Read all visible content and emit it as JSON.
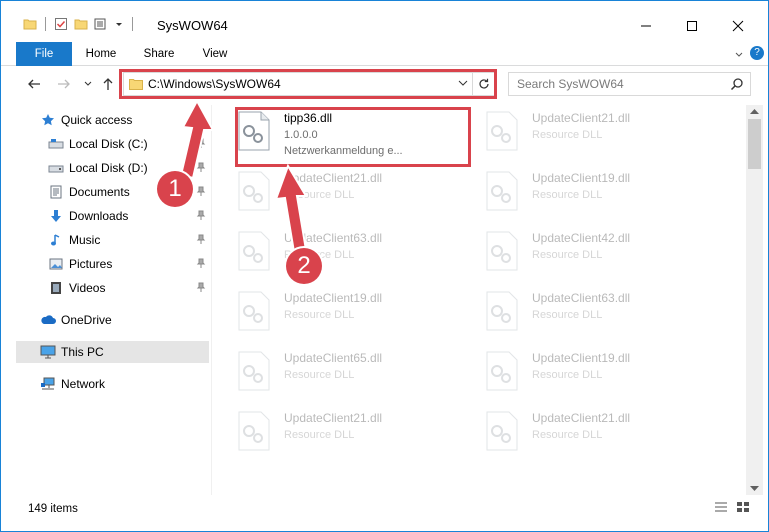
{
  "window": {
    "title": "SysWOW64"
  },
  "ribbon": {
    "tabs": [
      "File",
      "Home",
      "Share",
      "View"
    ]
  },
  "address": {
    "path": "C:\\Windows\\SysWOW64"
  },
  "search": {
    "placeholder": "Search SysWOW64"
  },
  "sidebar": {
    "items": [
      {
        "label": "Quick access",
        "icon": "star-icon",
        "pinned": false
      },
      {
        "label": "Local Disk (C:)",
        "icon": "drive-icon",
        "pinned": true
      },
      {
        "label": "Local Disk (D:)",
        "icon": "drive-icon",
        "pinned": true
      },
      {
        "label": "Documents",
        "icon": "documents-icon",
        "pinned": true
      },
      {
        "label": "Downloads",
        "icon": "download-arrow-icon",
        "pinned": true
      },
      {
        "label": "Music",
        "icon": "music-note-icon",
        "pinned": true
      },
      {
        "label": "Pictures",
        "icon": "pictures-icon",
        "pinned": true
      },
      {
        "label": "Videos",
        "icon": "film-icon",
        "pinned": true
      },
      {
        "label": "OneDrive",
        "icon": "cloud-icon",
        "pinned": false
      },
      {
        "label": "This PC",
        "icon": "monitor-icon",
        "pinned": false,
        "selected": true
      },
      {
        "label": "Network",
        "icon": "network-icon",
        "pinned": false
      }
    ]
  },
  "files": [
    {
      "name": "tipp36.dll",
      "line2": "1.0.0.0",
      "line3": "Netzwerkanmeldung e...",
      "highlighted": true
    },
    {
      "name": "UpdateClient21.dll",
      "line2": "Resource DLL",
      "faded": true
    },
    {
      "name": "UpdateClient21.dll",
      "line2": "Resource DLL",
      "faded": true
    },
    {
      "name": "UpdateClient19.dll",
      "line2": "Resource DLL",
      "faded": true
    },
    {
      "name": "UpdateClient63.dll",
      "line2": "Resource DLL",
      "faded": true
    },
    {
      "name": "UpdateClient42.dll",
      "line2": "Resource DLL",
      "faded": true
    },
    {
      "name": "UpdateClient19.dll",
      "line2": "Resource DLL",
      "faded": true
    },
    {
      "name": "UpdateClient63.dll",
      "line2": "Resource DLL",
      "faded": true
    },
    {
      "name": "UpdateClient65.dll",
      "line2": "Resource DLL",
      "faded": true
    },
    {
      "name": "UpdateClient19.dll",
      "line2": "Resource DLL",
      "faded": true
    },
    {
      "name": "UpdateClient21.dll",
      "line2": "Resource DLL",
      "faded": true
    },
    {
      "name": "UpdateClient21.dll",
      "line2": "Resource DLL",
      "faded": true
    }
  ],
  "status": {
    "item_count": "149 items"
  },
  "annotations": {
    "step1": "1",
    "step2": "2",
    "color": "#d9434c"
  }
}
